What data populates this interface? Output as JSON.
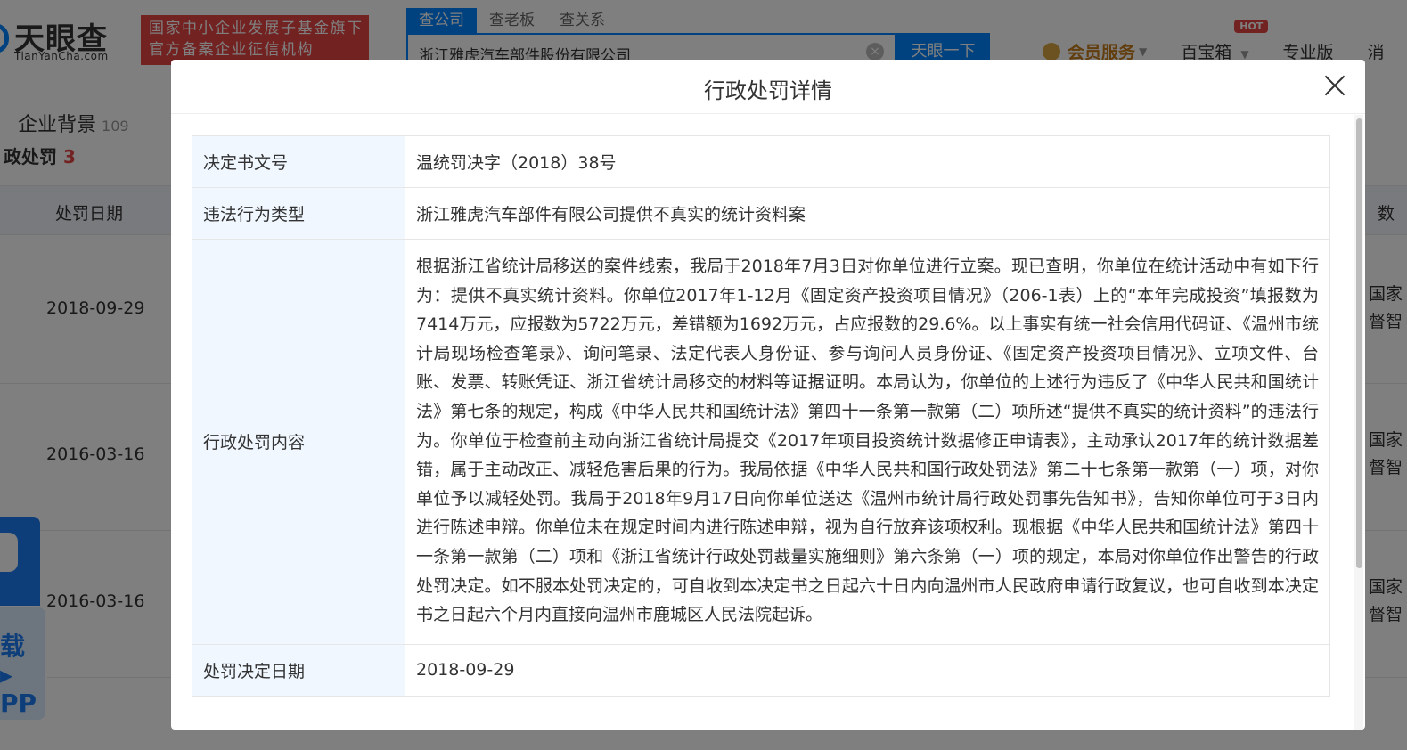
{
  "header": {
    "logo_text": "天眼查",
    "logo_sub": "TianYanCha.com",
    "slogan_line1": "国家中小企业发展子基金旗下",
    "slogan_line2": "官方备案企业征信机构",
    "search_tabs": [
      "查公司",
      "查老板",
      "查关系"
    ],
    "search_value": "浙江雅虎汽车部件股份有限公司",
    "search_button": "天眼一下",
    "vip_label": "会员服务",
    "treasure_label": "百宝箱",
    "hot_badge": "HOT",
    "pro_label": "专业版",
    "more_label": "消"
  },
  "section": {
    "title": "企业背景",
    "count": "109",
    "sub_title": "政处罚",
    "sub_count": "3"
  },
  "table": {
    "col_date": "处罚日期",
    "col_right": "数",
    "rows": [
      {
        "date": "2018-09-29",
        "right1": "国家",
        "right2": "督智"
      },
      {
        "date": "2016-03-16",
        "right1": "国家",
        "right2": "督智"
      },
      {
        "date": "2016-03-16",
        "right1": "国家",
        "right2": "督智"
      }
    ]
  },
  "app_promo": {
    "line1": "载 ▸",
    "line2": "PP"
  },
  "modal": {
    "title": "行政处罚详情",
    "rows": [
      {
        "label": "决定书文号",
        "value": "温统罚决字（2018）38号"
      },
      {
        "label": "违法行为类型",
        "value": "浙江雅虎汽车部件有限公司提供不真实的统计资料案"
      },
      {
        "label": "行政处罚内容",
        "value": "根据浙江省统计局移送的案件线索，我局于2018年7月3日对你单位进行立案。现已查明，你单位在统计活动中有如下行为：提供不真实统计资料。你单位2017年1-12月《固定资产投资项目情况》（206-1表）上的“本年完成投资”填报数为7414万元，应报数为5722万元，差错额为1692万元，占应报数的29.6%。以上事实有统一社会信用代码证、《温州市统计局现场检查笔录》、询问笔录、法定代表人身份证、参与询问人员身份证、《固定资产投资项目情况》、立项文件、台账、发票、转账凭证、浙江省统计局移交的材料等证据证明。本局认为，你单位的上述行为违反了《中华人民共和国统计法》第七条的规定，构成《中华人民共和国统计法》第四十一条第一款第（二）项所述“提供不真实的统计资料”的违法行为。你单位于检查前主动向浙江省统计局提交《2017年项目投资统计数据修正申请表》，主动承认2017年的统计数据差错，属于主动改正、减轻危害后果的行为。我局依据《中华人民共和国行政处罚法》第二十七条第一款第（一）项，对你单位予以减轻处罚。我局于2018年9月17日向你单位送达《温州市统计局行政处罚事先告知书》，告知你单位可于3日内进行陈述申辩。你单位未在规定时间内进行陈述申辩，视为自行放弃该项权利。现根据《中华人民共和国统计法》第四十一条第一款第（二）项和《浙江省统计行政处罚裁量实施细则》第六条第（一）项的规定，本局对你单位作出警告的行政处罚决定。如不服本处罚决定的，可自收到本决定书之日起六十日内向温州市人民政府申请行政复议，也可自收到本决定书之日起六个月内直接向温州市鹿城区人民法院起诉。"
      },
      {
        "label": "处罚决定日期",
        "value": "2018-09-29"
      }
    ]
  }
}
